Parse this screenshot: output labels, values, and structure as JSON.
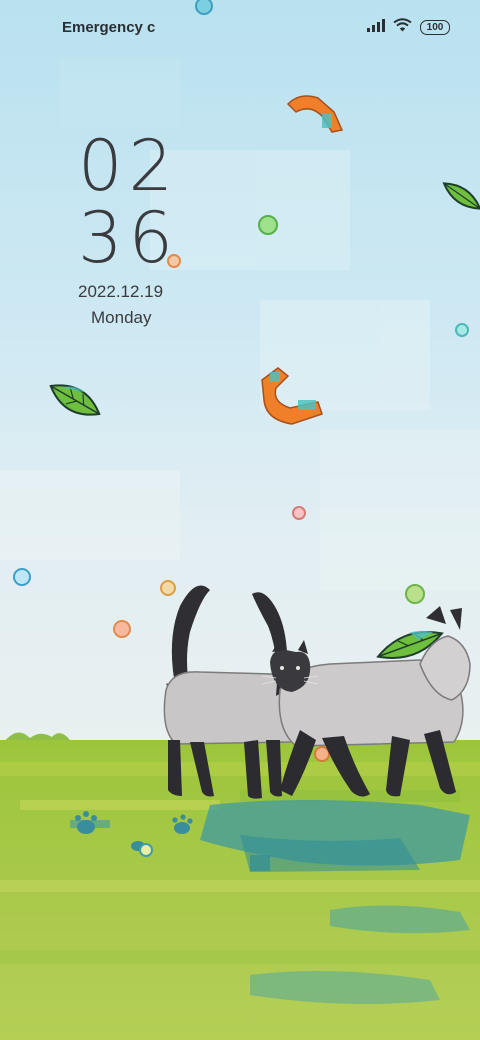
{
  "status_bar": {
    "carrier": "Emergency c",
    "signal_icon": "cellular-signal-icon",
    "wifi_icon": "wifi-icon",
    "battery_level": "100"
  },
  "lock_screen": {
    "hour": "02",
    "minute": "36",
    "date": "2022.12.19",
    "weekday": "Monday"
  },
  "wallpaper": {
    "subject": "two siamese cats walking in a meadow with falling leaves",
    "sky_color": "#cfe9f3",
    "grass_color": "#a9c94a",
    "accent_orange": "#f07f2a",
    "accent_green": "#6fbf3e"
  }
}
